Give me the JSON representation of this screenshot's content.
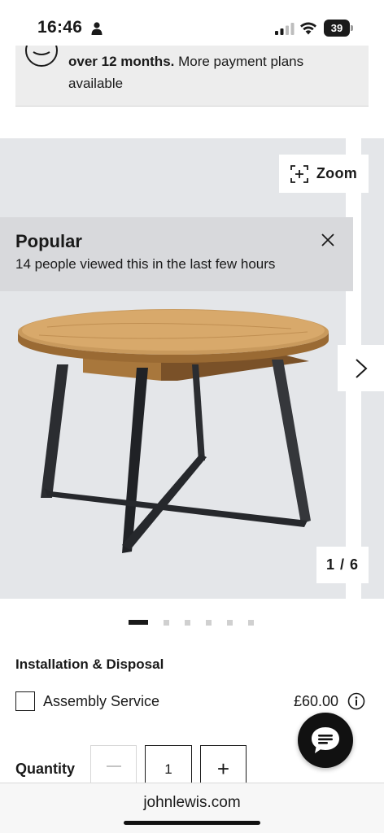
{
  "status_bar": {
    "time": "16:46",
    "battery": "39"
  },
  "payment_banner": {
    "bold_text": "over 12 months.",
    "text_after_bold": " More payment plans",
    "line2": "available"
  },
  "gallery": {
    "zoom_label": "Zoom",
    "popular_title": "Popular",
    "popular_subtitle": "14 people viewed this in the last few hours",
    "counter": "1 / 6",
    "dots_total": 6,
    "active_dot": 1
  },
  "installation": {
    "heading": "Installation & Disposal",
    "assembly_label": "Assembly Service",
    "assembly_price": "£60.00"
  },
  "quantity": {
    "label": "Quantity",
    "value": "1",
    "plus": "+"
  },
  "browser": {
    "url": "johnlewis.com"
  },
  "colors": {
    "gallery_bg": "#e4e6e9",
    "popular_bg": "#d8d9dc",
    "banner_bg": "#ededed"
  }
}
